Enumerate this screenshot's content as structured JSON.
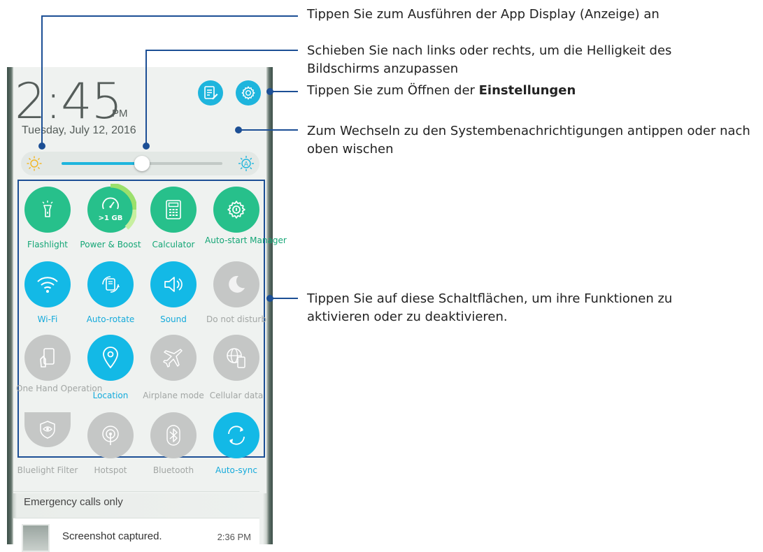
{
  "callouts": {
    "display": "Tippen Sie zum Ausführen der App Display (Anzeige) an",
    "brightness": "Schieben Sie nach links oder rechts, um die Helligkeit des Bildschirms anzupassen",
    "settings_prefix": "Tippen Sie zum Öffnen der ",
    "settings_bold": "Einstellungen",
    "notifications": "Zum Wechseln zu den Systembenachrichtigungen antippen oder nach oben wischen",
    "tiles": "Tippen Sie auf diese Schaltflächen, um ihre Funktionen zu aktivieren oder zu deaktivieren."
  },
  "status": {
    "time": "2:45",
    "ampm": "PM",
    "date": "Tuesday, July 12, 2016"
  },
  "brightness": {
    "level": 0.5
  },
  "tiles": [
    {
      "label": "Flashlight",
      "icon": "flashlight-icon",
      "state": "green"
    },
    {
      "label": "Power & Boost",
      "icon": "speedometer-icon",
      "state": "green",
      "badge": ">1 GB"
    },
    {
      "label": "Calculator",
      "icon": "calculator-icon",
      "state": "green"
    },
    {
      "label": "Auto-start Manager",
      "icon": "gear-icon",
      "state": "green"
    },
    {
      "label": "Wi-Fi",
      "icon": "wifi-icon",
      "state": "blue"
    },
    {
      "label": "Auto-rotate",
      "icon": "rotate-icon",
      "state": "blue"
    },
    {
      "label": "Sound",
      "icon": "speaker-icon",
      "state": "blue"
    },
    {
      "label": "Do not disturb",
      "icon": "moon-icon",
      "state": "grey"
    },
    {
      "label": "One Hand Operation",
      "icon": "one-hand-icon",
      "state": "grey"
    },
    {
      "label": "Location",
      "icon": "location-pin-icon",
      "state": "blue"
    },
    {
      "label": "Airplane mode",
      "icon": "airplane-icon",
      "state": "grey"
    },
    {
      "label": "Cellular data",
      "icon": "globe-phone-icon",
      "state": "grey"
    },
    {
      "label": "Bluelight Filter",
      "icon": "eye-shield-icon",
      "state": "grey"
    },
    {
      "label": "Hotspot",
      "icon": "hotspot-icon",
      "state": "grey"
    },
    {
      "label": "Bluetooth",
      "icon": "bluetooth-icon",
      "state": "grey"
    },
    {
      "label": "Auto-sync",
      "icon": "sync-icon",
      "state": "blue"
    }
  ],
  "notifications": {
    "emergency": "Emergency calls only",
    "screenshot_title": "Screenshot captured.",
    "screenshot_time": "2:36 PM"
  },
  "colors": {
    "accent_blue": "#13b9e6",
    "tile_green": "#27c08b",
    "tile_grey": "#c5c7c6",
    "callout_line": "#1c4f95"
  }
}
